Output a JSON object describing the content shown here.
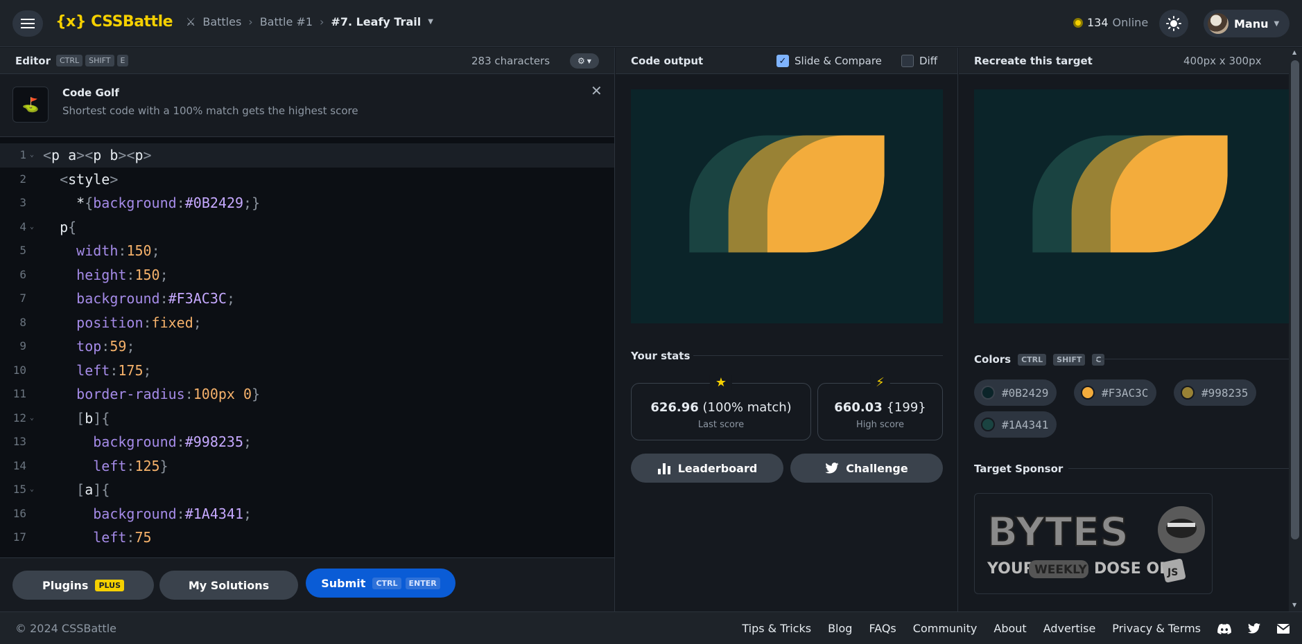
{
  "header": {
    "logo": "{x} CSSBattle",
    "breadcrumb": [
      "Battles",
      "Battle #1",
      "#7. Leafy Trail"
    ],
    "online_count": "134",
    "online_label": "Online",
    "user_name": "Manu"
  },
  "editor": {
    "title": "Editor",
    "shortcut": [
      "CTRL",
      "SHIFT",
      "E"
    ],
    "char_count": "283 characters",
    "golf_title": "Code Golf",
    "golf_desc": "Shortest code with a 100% match gets the highest score",
    "code_lines": [
      "<p a><p b><p>",
      "  <style>",
      "    *{background:#0B2429;}",
      "  p{",
      "    width:150;",
      "    height:150;",
      "    background:#F3AC3C;",
      "    position:fixed;",
      "    top:59;",
      "    left:175;",
      "    border-radius:100px 0}",
      "    [b]{",
      "      background:#998235;",
      "      left:125}",
      "    [a]{",
      "      background:#1A4341;",
      "      left:75"
    ],
    "plugins_label": "Plugins",
    "plus_badge": "PLUS",
    "solutions_label": "My Solutions",
    "submit_label": "Submit",
    "submit_shortcut": [
      "CTRL",
      "ENTER"
    ]
  },
  "output": {
    "title": "Code output",
    "slide_compare_label": "Slide & Compare",
    "slide_compare_checked": true,
    "diff_label": "Diff",
    "diff_checked": false,
    "stats_title": "Your stats",
    "last_score_value": "626.96",
    "last_score_match": "(100% match)",
    "last_score_label": "Last score",
    "high_score_value": "660.03",
    "high_score_chars": "{199}",
    "high_score_label": "High score",
    "leaderboard_label": "Leaderboard",
    "challenge_label": "Challenge"
  },
  "target": {
    "title": "Recreate this target",
    "size": "400px x 300px",
    "colors_title": "Colors",
    "colors_shortcut": [
      "CTRL",
      "SHIFT",
      "C"
    ],
    "colors": [
      "#0B2429",
      "#F3AC3C",
      "#998235",
      "#1A4341"
    ],
    "sponsor_title": "Target Sponsor",
    "sponsor_logo_text": "BYTES YOUR WEEKLY DOSE OF JS"
  },
  "footer": {
    "copyright": "© 2024 CSSBattle",
    "links": [
      "Tips & Tricks",
      "Blog",
      "FAQs",
      "Community",
      "About",
      "Advertise",
      "Privacy & Terms"
    ]
  }
}
